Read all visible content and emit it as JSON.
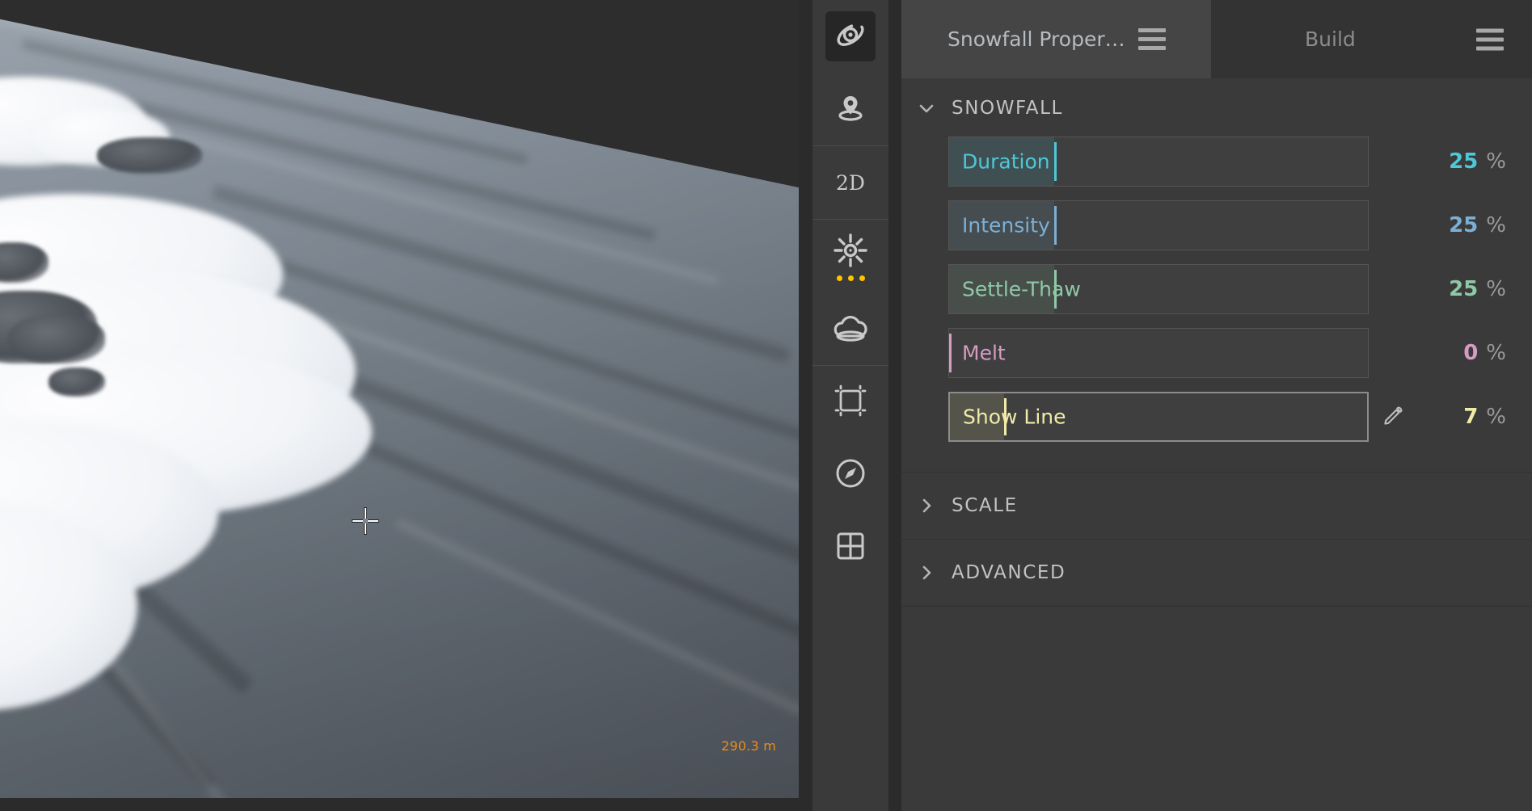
{
  "viewport": {
    "elevation_label": "290.3 m",
    "elevation_color": "#f08a1e",
    "cursor_icon": "crosshair-cursor"
  },
  "toolbar": {
    "groups": [
      {
        "items": [
          {
            "name": "orbit-icon",
            "label": "",
            "selected": true
          },
          {
            "name": "location-pin-icon",
            "label": "",
            "selected": false
          }
        ]
      },
      {
        "items": [
          {
            "name": "two-d-view-label",
            "label": "2D",
            "selected": false
          }
        ]
      },
      {
        "items": [
          {
            "name": "sun-icon",
            "label": "",
            "selected": false
          },
          {
            "name": "cloud-icon",
            "label": "",
            "selected": false
          }
        ]
      },
      {
        "items": [
          {
            "name": "crop-frame-icon",
            "label": "",
            "selected": false
          },
          {
            "name": "compass-icon",
            "label": "",
            "selected": false
          },
          {
            "name": "grid-layout-icon",
            "label": "",
            "selected": false
          }
        ]
      }
    ],
    "sun_dots_color": "#ffc400"
  },
  "panel": {
    "tabs": [
      {
        "label": "Snowfall Proper…",
        "active": true,
        "menu_icon": "hamburger-icon"
      },
      {
        "label": "Build",
        "active": false
      }
    ],
    "menu_icon": "hamburger-icon",
    "sections": [
      {
        "id": "snowfall",
        "title": "SNOWFALL",
        "expanded": true,
        "chevron_icon": "chevron-down-icon",
        "properties": [
          {
            "label": "Duration",
            "value": "25",
            "unit": "%",
            "percent": 25,
            "color": "#4dc8d8",
            "has_picker": false
          },
          {
            "label": "Intensity",
            "value": "25",
            "unit": "%",
            "percent": 25,
            "color": "#7bafd4",
            "has_picker": false
          },
          {
            "label": "Settle-Thaw",
            "value": "25",
            "unit": "%",
            "percent": 25,
            "color": "#8fc9a8",
            "has_picker": false
          },
          {
            "label": "Melt",
            "value": "0",
            "unit": "%",
            "percent": 0,
            "color": "#d49cc4",
            "has_picker": false
          },
          {
            "label": "Show Line",
            "value": "7",
            "unit": "%",
            "percent": 7,
            "color": "#f0eba8",
            "has_picker": true,
            "picker_icon": "eyedropper-icon",
            "selected": true
          }
        ]
      },
      {
        "id": "scale",
        "title": "SCALE",
        "expanded": false,
        "chevron_icon": "chevron-right-icon",
        "properties": []
      },
      {
        "id": "advanced",
        "title": "ADVANCED",
        "expanded": false,
        "chevron_icon": "chevron-right-icon",
        "properties": []
      }
    ]
  }
}
